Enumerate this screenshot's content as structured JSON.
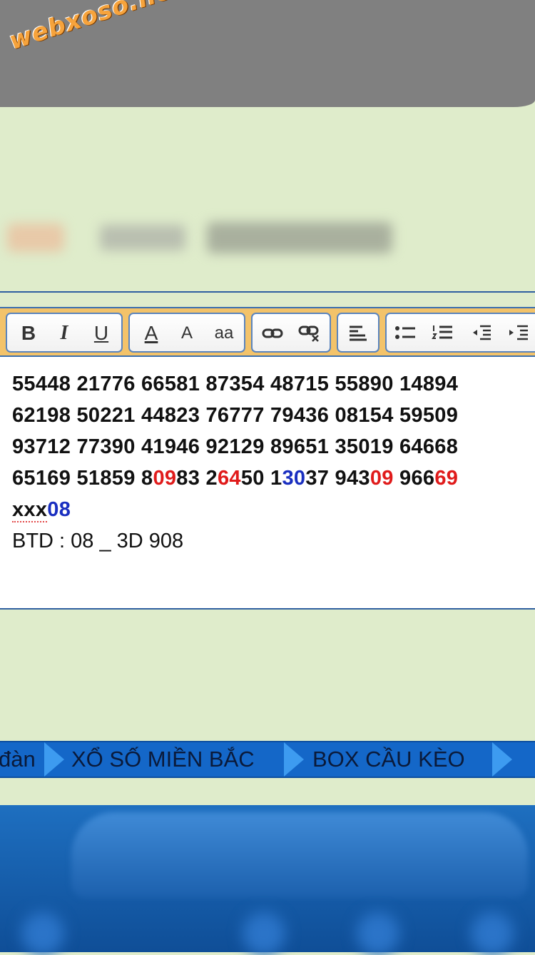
{
  "watermark": "webxoso.net",
  "editor": {
    "toolbar": {
      "bold": "B",
      "italic": "I",
      "underline": "U",
      "font_color": "A",
      "font_size": "A",
      "font_family": "aa"
    },
    "lines": [
      [
        "55448 21776 66581 87354 48715 55890 14894"
      ],
      [
        "62198 50221 44823 76777 79436 08154 59509"
      ],
      [
        "93712 77390 41946 92129 89651 35019 64668"
      ]
    ],
    "line4": {
      "p1": "65169 51859 8",
      "r1": "09",
      "p2": "83 2",
      "r2": "64",
      "p3": "50 1",
      "b1": "30",
      "p4": "37 943",
      "r3": "09",
      "p5": " 966",
      "r4": "69"
    },
    "line5": {
      "prefix": "xxx",
      "num": "08"
    },
    "btd": "BTD : 08 _ 3D 908"
  },
  "nav": {
    "items": [
      "đàn",
      "XỔ SỐ MIỀN BẮC",
      "BOX CẦU KÈO"
    ]
  },
  "colors": {
    "accent_blue": "#1467c8",
    "highlight_red": "#e01b1b",
    "highlight_blue": "#1a2fc0",
    "toolbar_bg": "#f3c36a",
    "page_bg": "#dfeccb"
  }
}
